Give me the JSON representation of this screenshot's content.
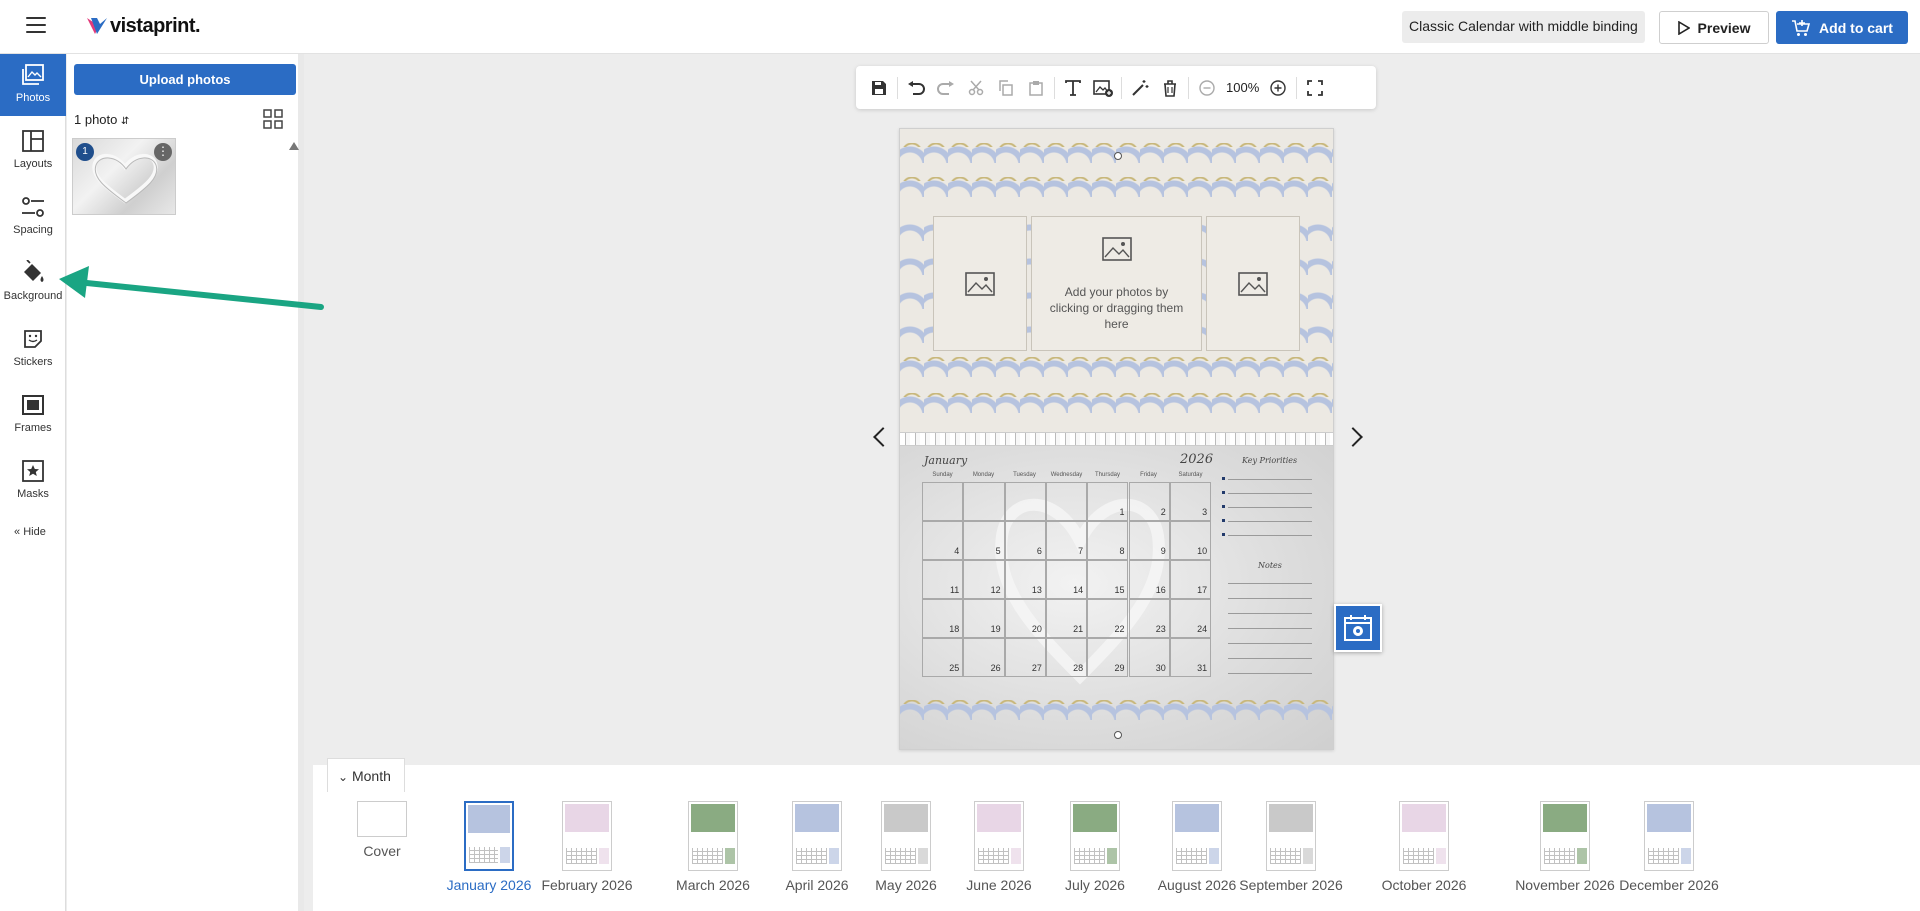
{
  "header": {
    "logo_text": "vistaprint.",
    "project_name": "Classic Calendar with middle binding",
    "preview_label": "Preview",
    "cart_label": "Add to cart"
  },
  "leftnav": {
    "items": [
      {
        "label": "Photos",
        "icon": "photos-icon",
        "active": true
      },
      {
        "label": "Layouts",
        "icon": "layouts-icon"
      },
      {
        "label": "Spacing",
        "icon": "spacing-icon"
      },
      {
        "label": "Background",
        "icon": "paint-bucket-icon"
      },
      {
        "label": "Stickers",
        "icon": "sticker-icon"
      },
      {
        "label": "Frames",
        "icon": "frame-icon"
      },
      {
        "label": "Masks",
        "icon": "mask-star-icon"
      }
    ],
    "hide_label": "Hide"
  },
  "photos_panel": {
    "upload_label": "Upload photos",
    "count_label": "1 photo",
    "photos": [
      {
        "badge": "1",
        "more": "⋮"
      }
    ]
  },
  "toolbar": {
    "zoom": "100%"
  },
  "canvas": {
    "slot_text": "Add your photos by clicking or dragging them here",
    "month": "January",
    "year": "2026",
    "day_headers": [
      "Sunday",
      "Monday",
      "Tuesday",
      "Wednesday",
      "Thursday",
      "Friday",
      "Saturday"
    ],
    "weeks": [
      [
        "",
        "",
        "",
        "",
        "1",
        "2",
        "3"
      ],
      [
        "4",
        "5",
        "6",
        "7",
        "8",
        "9",
        "10"
      ],
      [
        "11",
        "12",
        "13",
        "14",
        "15",
        "16",
        "17"
      ],
      [
        "18",
        "19",
        "20",
        "21",
        "22",
        "23",
        "24"
      ],
      [
        "25",
        "26",
        "27",
        "28",
        "29",
        "30",
        "31"
      ]
    ],
    "side_title_1": "Key Priorities",
    "side_title_2": "Notes"
  },
  "monthbar": {
    "tab_label": "Month",
    "pages": [
      {
        "label": "Cover",
        "theme": "#ffffff"
      },
      {
        "label": "January 2026",
        "theme": "#b6c3df",
        "active": true
      },
      {
        "label": "February 2026",
        "theme": "#e8d6e6"
      },
      {
        "label": "March 2026",
        "theme": "#8aab82"
      },
      {
        "label": "April 2026",
        "theme": "#b6c3df"
      },
      {
        "label": "May 2026",
        "theme": "#c9c9c9"
      },
      {
        "label": "June 2026",
        "theme": "#e8d6e6"
      },
      {
        "label": "July 2026",
        "theme": "#8aab82"
      },
      {
        "label": "August 2026",
        "theme": "#b6c3df"
      },
      {
        "label": "September 2026",
        "theme": "#c9c9c9"
      },
      {
        "label": "October 2026",
        "theme": "#e8d6e6"
      },
      {
        "label": "November 2026",
        "theme": "#8aab82"
      },
      {
        "label": "December 2026",
        "theme": "#b6c3df"
      }
    ]
  },
  "colors": {
    "accent": "#2b6cc4",
    "annotation_arrow": "#1aa583"
  }
}
